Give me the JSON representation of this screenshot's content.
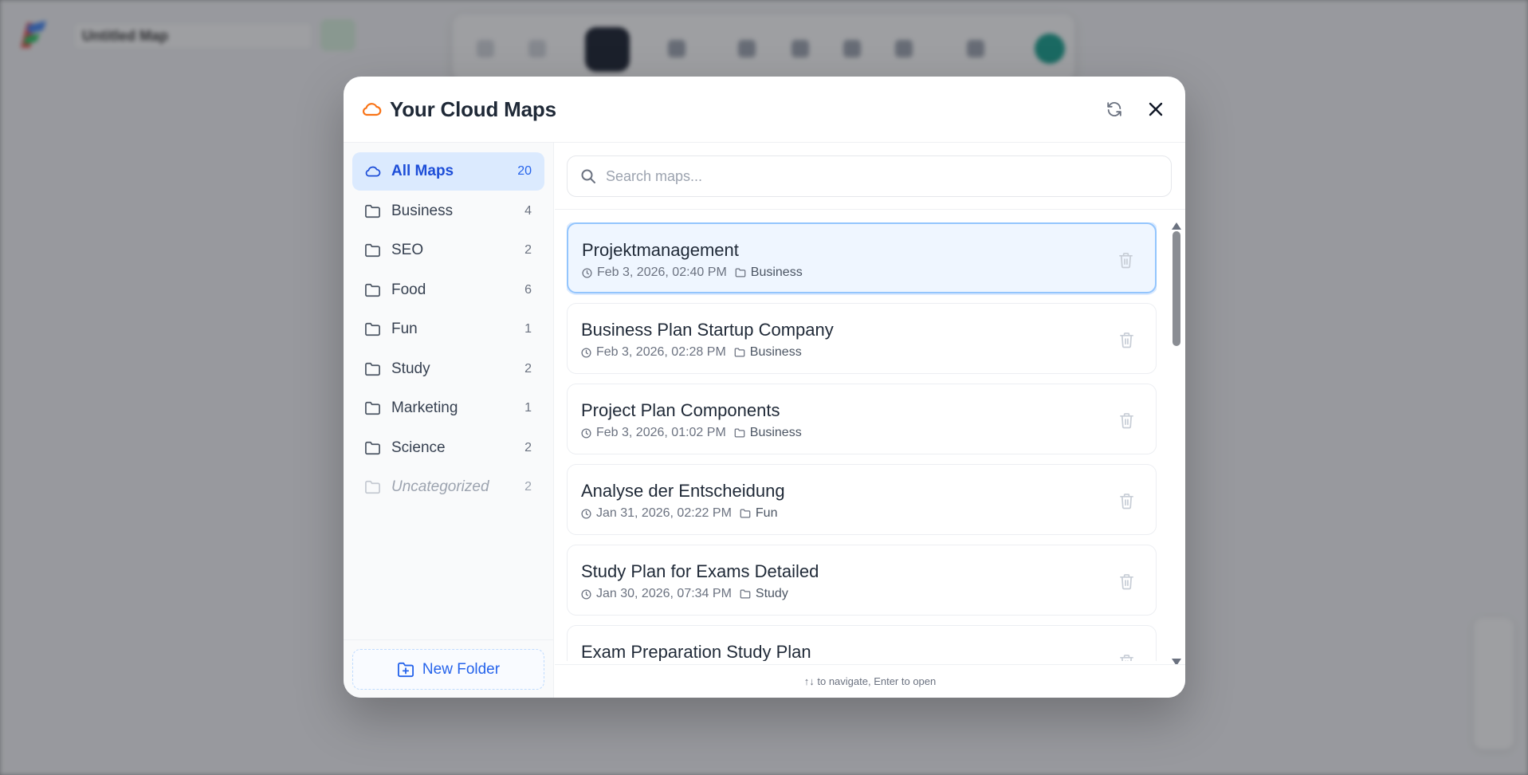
{
  "background": {
    "document_title": "Untitled Map"
  },
  "modal": {
    "title": "Your Cloud Maps",
    "refresh_icon": "refresh-icon",
    "close_icon": "close-icon"
  },
  "sidebar": {
    "folders": [
      {
        "label": "All Maps",
        "count": "20",
        "icon": "cloud-icon",
        "active": true
      },
      {
        "label": "Business",
        "count": "4",
        "icon": "folder-icon"
      },
      {
        "label": "SEO",
        "count": "2",
        "icon": "folder-icon"
      },
      {
        "label": "Food",
        "count": "6",
        "icon": "folder-icon"
      },
      {
        "label": "Fun",
        "count": "1",
        "icon": "folder-icon"
      },
      {
        "label": "Study",
        "count": "2",
        "icon": "folder-icon"
      },
      {
        "label": "Marketing",
        "count": "1",
        "icon": "folder-icon"
      },
      {
        "label": "Science",
        "count": "2",
        "icon": "folder-icon"
      },
      {
        "label": "Uncategorized",
        "count": "2",
        "icon": "folder-icon"
      }
    ],
    "new_folder_label": "New Folder"
  },
  "search": {
    "placeholder": "Search maps...",
    "value": ""
  },
  "maps": [
    {
      "name": "Projektmanagement",
      "date": "Feb 3, 2026, 02:40 PM",
      "category": "Business"
    },
    {
      "name": "Business Plan Startup Company",
      "date": "Feb 3, 2026, 02:28 PM",
      "category": "Business"
    },
    {
      "name": "Project Plan Components",
      "date": "Feb 3, 2026, 01:02 PM",
      "category": "Business"
    },
    {
      "name": "Analyse der Entscheidung",
      "date": "Jan 31, 2026, 02:22 PM",
      "category": "Fun"
    },
    {
      "name": "Study Plan for Exams Detailed",
      "date": "Jan 30, 2026, 07:34 PM",
      "category": "Study"
    },
    {
      "name": "Exam Preparation Study Plan",
      "date": "",
      "category": ""
    }
  ],
  "footer_hint": "↑↓ to navigate, Enter to open",
  "colors": {
    "accent": "#2563eb",
    "cloud_orange": "#f97316",
    "active_bg": "#dbeafe"
  }
}
